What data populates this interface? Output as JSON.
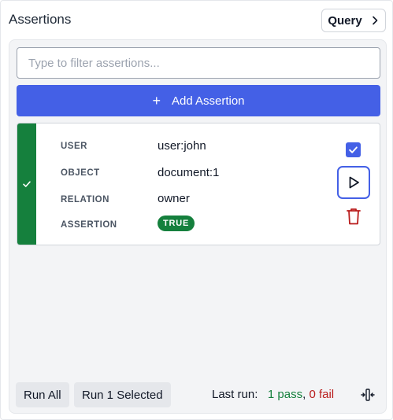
{
  "header": {
    "title": "Assertions",
    "query_label": "Query"
  },
  "filter": {
    "placeholder": "Type to filter assertions...",
    "value": ""
  },
  "add_button": {
    "label": "Add Assertion"
  },
  "assertion": {
    "status": "pass",
    "selected": true,
    "fields": {
      "user_label": "USER",
      "user_value": "user:john",
      "object_label": "OBJECT",
      "object_value": "document:1",
      "relation_label": "RELATION",
      "relation_value": "owner",
      "assertion_label": "ASSERTION",
      "assertion_value": "TRUE"
    }
  },
  "footer": {
    "run_all_label": "Run All",
    "run_selected_label": "Run 1 Selected",
    "last_run_label": "Last run:",
    "pass_text": "1 pass",
    "separator": ",",
    "fail_text": "0 fail"
  },
  "colors": {
    "accent": "#4460e6",
    "pass": "#15803d",
    "fail": "#b91c1c"
  },
  "icons": {
    "query": "chevron-right-icon",
    "add": "plus-icon",
    "status": "check-icon",
    "run": "play-icon",
    "delete": "trash-icon",
    "collapse": "collapse-panel-icon"
  }
}
